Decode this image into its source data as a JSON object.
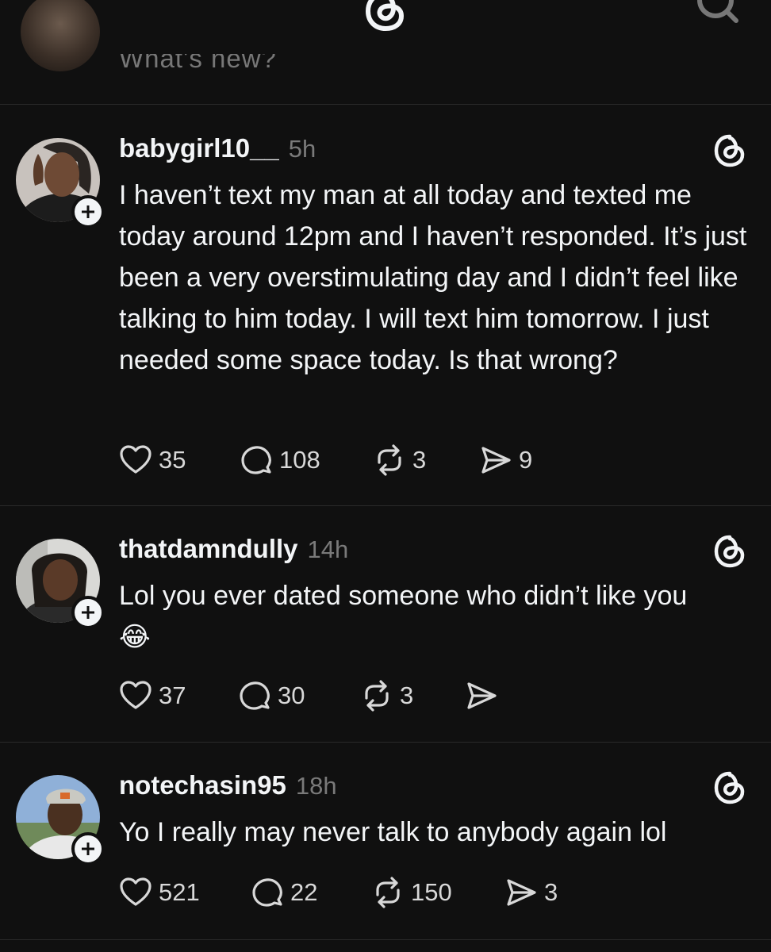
{
  "composer": {
    "placeholder": "What's new?"
  },
  "posts": [
    {
      "username": "babygirl10__",
      "time": "5h",
      "text": "I haven’t text my man at all today and texted me today around 12pm and I haven’t responded. It’s just been a very overstimulating day and I didn’t feel like talking to him today. I will text him tomorrow. I just needed some space today. Is that wrong?",
      "likes": "35",
      "replies": "108",
      "reposts": "3",
      "shares": "9"
    },
    {
      "username": "thatdamndully",
      "time": "14h",
      "text": "Lol you ever dated someone who didn’t like you 😂",
      "likes": "37",
      "replies": "30",
      "reposts": "3",
      "shares": ""
    },
    {
      "username": "notechasin95",
      "time": "18h",
      "text": "Yo I really may never talk to anybody again lol",
      "likes": "521",
      "replies": "22",
      "reposts": "150",
      "shares": "3"
    }
  ],
  "icons": {
    "menu": "menu-icon",
    "logo": "threads-logo-icon",
    "search": "search-icon",
    "like": "heart-icon",
    "reply": "comment-icon",
    "repost": "repost-icon",
    "share": "send-icon",
    "follow": "plus-icon"
  },
  "colors": {
    "background": "#101010",
    "text": "#f3f5f7",
    "muted": "#7a7a7a",
    "divider": "#2a2a2a"
  }
}
